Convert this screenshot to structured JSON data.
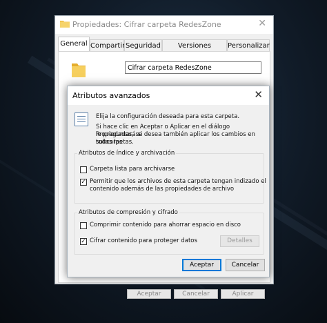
{
  "props_window": {
    "title": "Propiedades: Cifrar carpeta RedesZone",
    "close_glyph": "✕",
    "tabs": [
      {
        "label": "General",
        "active": true
      },
      {
        "label": "Compartir",
        "active": false
      },
      {
        "label": "Seguridad",
        "active": false
      },
      {
        "label": "Versiones anteriores",
        "active": false
      },
      {
        "label": "Personalizar",
        "active": false
      }
    ],
    "folder_name": "Cifrar carpeta RedesZone",
    "buttons": {
      "accept": "Aceptar",
      "cancel": "Cancelar",
      "apply": "Aplicar"
    }
  },
  "advanced_dialog": {
    "title": "Atributos avanzados",
    "close_glyph": "✕",
    "intro_line": "Elija la configuración deseada para esta carpeta.",
    "detail_lines": [
      "Si hace clic en Aceptar o Aplicar en el diálogo Propiedades, se",
      "le preguntará si desea también aplicar los cambios en todas las",
      "subcarpetas."
    ],
    "index_group": {
      "legend": "Atributos de índice y archivación",
      "archive": {
        "label": "Carpeta lista para archivarse",
        "checked": false
      },
      "index": {
        "label_line1": "Permitir que los archivos de esta carpeta tengan indizado el",
        "label_line2": "contenido además de las propiedades de archivo",
        "checked": true
      }
    },
    "compress_group": {
      "legend": "Atributos de compresión y cifrado",
      "compress": {
        "label": "Comprimir contenido para ahorrar espacio en disco",
        "checked": false
      },
      "encrypt": {
        "label": "Cifrar contenido para proteger datos",
        "checked": true
      },
      "details_button": "Detalles"
    },
    "buttons": {
      "ok": "Aceptar",
      "cancel": "Cancelar"
    }
  },
  "colors": {
    "accent": "#0078d7",
    "folder": "#f1c34d",
    "desktop": "#0f1a26"
  },
  "icons": [
    "folder-icon",
    "close-icon",
    "attributes-list-icon",
    "check-icon"
  ]
}
